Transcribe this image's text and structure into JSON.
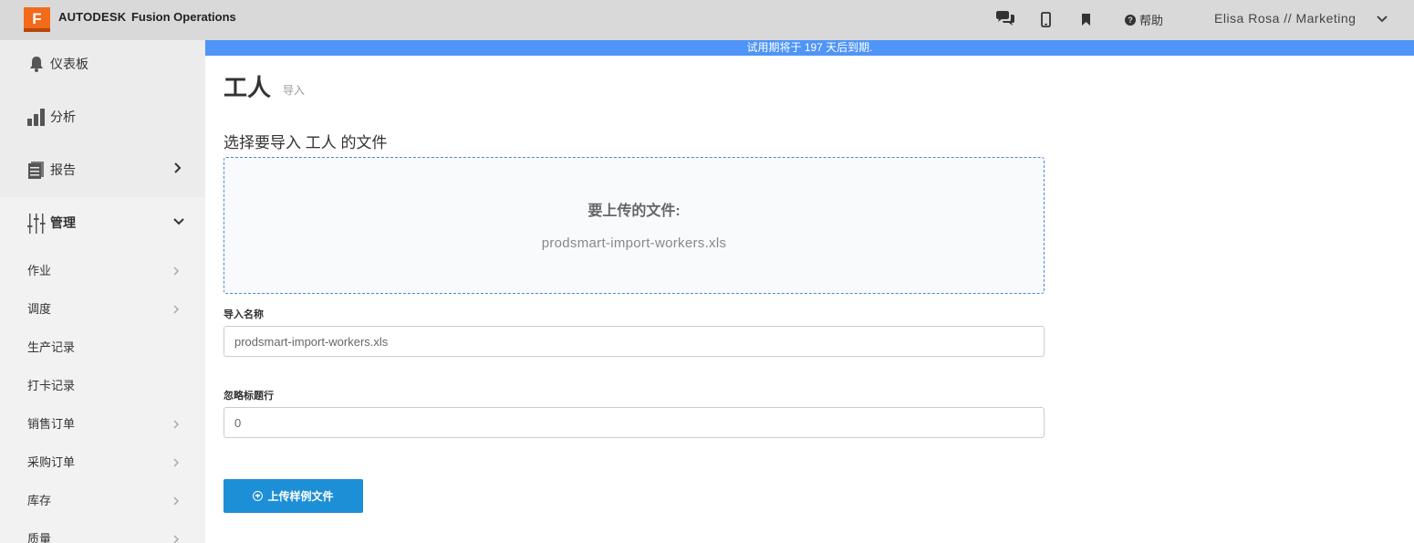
{
  "app": {
    "logo_letter": "F",
    "brand": "AUTODESK",
    "product": "Fusion Operations"
  },
  "header": {
    "help_label": "帮助",
    "help_icon": "question-circle-icon",
    "user_label": "Elisa Rosa // Marketing",
    "icons": [
      "chat-icon",
      "mobile-icon",
      "bookmark-icon",
      "question-circle-icon",
      "chevron-down-icon"
    ]
  },
  "banner": {
    "text": "试用期将于 197 天后到期."
  },
  "sidebar": {
    "main_items": [
      {
        "label": "仪表板",
        "icon": "bell-icon"
      },
      {
        "label": "分析",
        "icon": "bar-chart-icon"
      },
      {
        "label": "报告",
        "icon": "report-icon"
      }
    ],
    "manage": {
      "label": "管理",
      "icon": "sliders-icon"
    },
    "sub_items": [
      {
        "label": "作业"
      },
      {
        "label": "调度"
      },
      {
        "label": "生产记录"
      },
      {
        "label": "打卡记录"
      },
      {
        "label": "销售订单"
      },
      {
        "label": "采购订单"
      },
      {
        "label": "库存"
      },
      {
        "label": "质量"
      }
    ]
  },
  "page": {
    "title": "工人",
    "subtitle": "导入",
    "section_title": "选择要导入 工人 的文件"
  },
  "dropzone": {
    "label": "要上传的文件:",
    "file_name": "prodsmart-import-workers.xls"
  },
  "form": {
    "import_name_label": "导入名称",
    "import_name_value": "prodsmart-import-workers.xls",
    "ignore_header_label": "忽略标题行",
    "ignore_header_value": "0"
  },
  "actions": {
    "upload_sample_label": "上传样例文件"
  },
  "colors": {
    "topbar": "#d9d9d9",
    "logo": "#f26a1b",
    "banner": "#4f94f7",
    "button": "#1c8fd6",
    "dropzone_border": "#4a8ad6"
  }
}
